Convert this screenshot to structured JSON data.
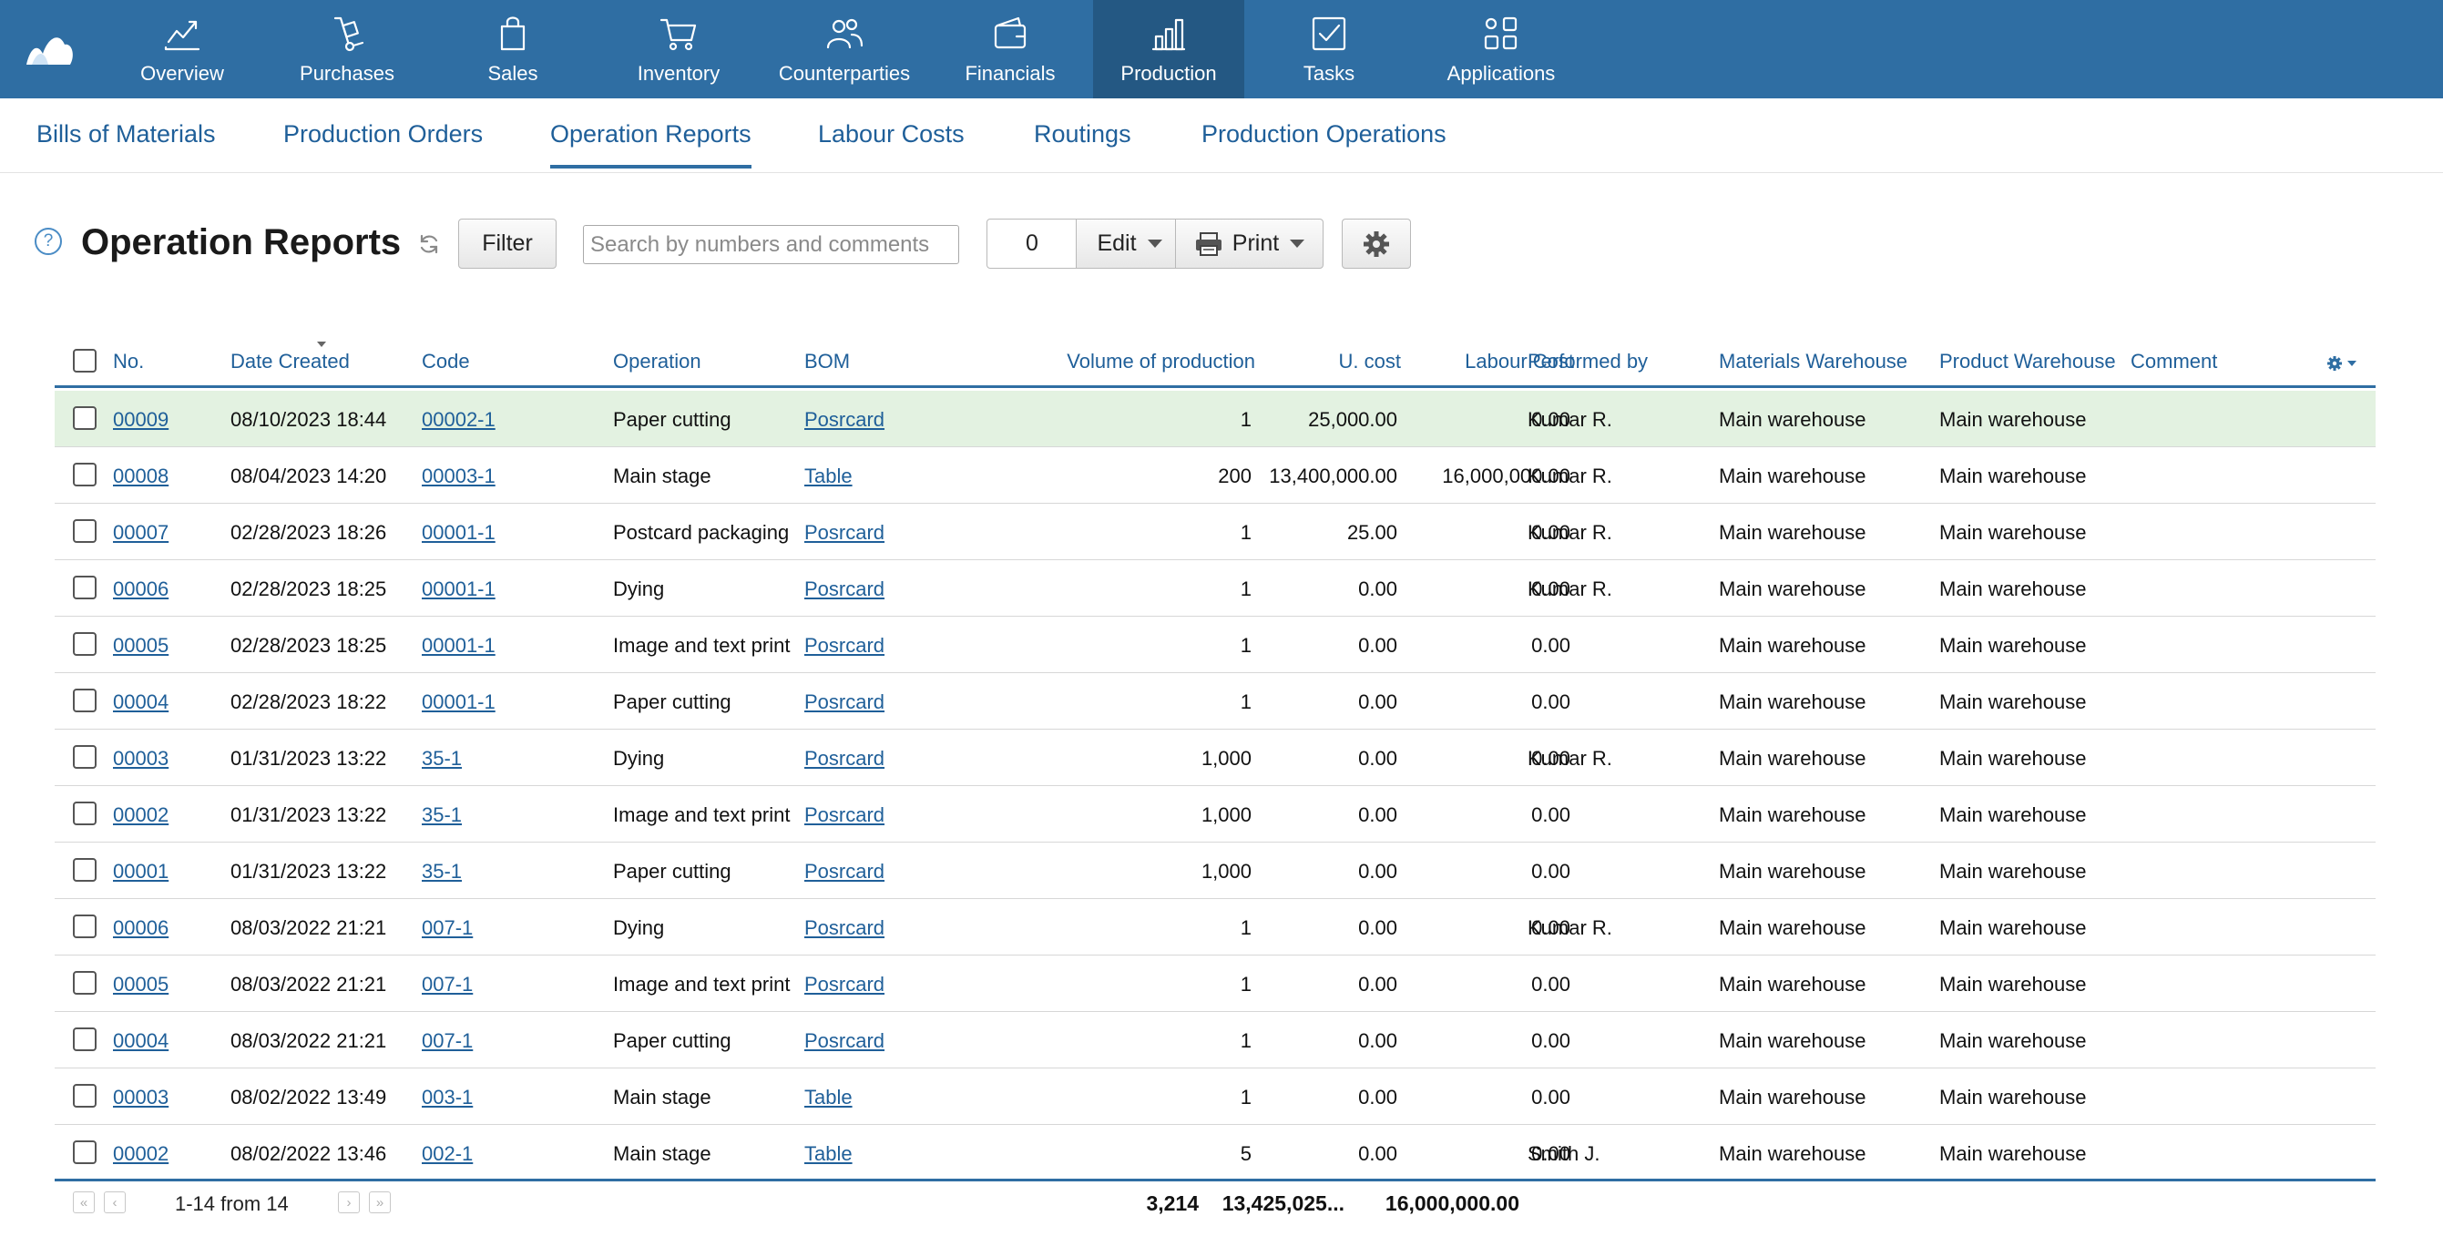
{
  "nav": {
    "items": [
      {
        "label": "Overview",
        "icon": "chart-line-icon"
      },
      {
        "label": "Purchases",
        "icon": "hand-truck-icon"
      },
      {
        "label": "Sales",
        "icon": "shopping-bag-icon"
      },
      {
        "label": "Inventory",
        "icon": "cart-icon"
      },
      {
        "label": "Counterparties",
        "icon": "people-icon"
      },
      {
        "label": "Financials",
        "icon": "wallet-icon"
      },
      {
        "label": "Production",
        "icon": "bar-chart-icon"
      },
      {
        "label": "Tasks",
        "icon": "checkbox-icon"
      },
      {
        "label": "Applications",
        "icon": "apps-icon"
      }
    ],
    "active": "Production"
  },
  "subnav": {
    "tabs": [
      "Bills of Materials",
      "Production Orders",
      "Operation Reports",
      "Labour Costs",
      "Routings",
      "Production Operations"
    ],
    "active": "Operation Reports"
  },
  "toolbar": {
    "title": "Operation Reports",
    "help": "?",
    "filter_label": "Filter",
    "search_placeholder": "Search by numbers and comments",
    "selected_count": "0",
    "edit_label": "Edit",
    "print_label": "Print"
  },
  "table": {
    "columns": {
      "no": "No.",
      "date": "Date Created",
      "code": "Code",
      "operation": "Operation",
      "bom": "BOM",
      "volume": "Volume of production",
      "ucost": "U. cost",
      "labour": "Labour Cost",
      "performed": "Performed by",
      "mat_wh": "Materials Warehouse",
      "prod_wh": "Product Warehouse",
      "comment": "Comment"
    },
    "rows": [
      {
        "no": "00009",
        "date": "08/10/2023 18:44",
        "code": "00002-1",
        "operation": "Paper cutting",
        "bom": "Posrcard",
        "volume": "1",
        "ucost": "25,000.00",
        "labour": "0.00",
        "performed": "Kumar R.",
        "mat_wh": "Main warehouse",
        "prod_wh": "Main warehouse",
        "comment": ""
      },
      {
        "no": "00008",
        "date": "08/04/2023 14:20",
        "code": "00003-1",
        "operation": "Main stage",
        "bom": "Table",
        "volume": "200",
        "ucost": "13,400,000.00",
        "labour": "16,000,000.00",
        "performed": "Kumar R.",
        "mat_wh": "Main warehouse",
        "prod_wh": "Main warehouse",
        "comment": ""
      },
      {
        "no": "00007",
        "date": "02/28/2023 18:26",
        "code": "00001-1",
        "operation": "Postcard packaging",
        "bom": "Posrcard",
        "volume": "1",
        "ucost": "25.00",
        "labour": "0.00",
        "performed": "Kumar R.",
        "mat_wh": "Main warehouse",
        "prod_wh": "Main warehouse",
        "comment": ""
      },
      {
        "no": "00006",
        "date": "02/28/2023 18:25",
        "code": "00001-1",
        "operation": "Dying",
        "bom": "Posrcard",
        "volume": "1",
        "ucost": "0.00",
        "labour": "0.00",
        "performed": "Kumar R.",
        "mat_wh": "Main warehouse",
        "prod_wh": "Main warehouse",
        "comment": ""
      },
      {
        "no": "00005",
        "date": "02/28/2023 18:25",
        "code": "00001-1",
        "operation": "Image and text print",
        "bom": "Posrcard",
        "volume": "1",
        "ucost": "0.00",
        "labour": "0.00",
        "performed": "",
        "mat_wh": "Main warehouse",
        "prod_wh": "Main warehouse",
        "comment": ""
      },
      {
        "no": "00004",
        "date": "02/28/2023 18:22",
        "code": "00001-1",
        "operation": "Paper cutting",
        "bom": "Posrcard",
        "volume": "1",
        "ucost": "0.00",
        "labour": "0.00",
        "performed": "",
        "mat_wh": "Main warehouse",
        "prod_wh": "Main warehouse",
        "comment": ""
      },
      {
        "no": "00003",
        "date": "01/31/2023 13:22",
        "code": "35-1",
        "operation": "Dying",
        "bom": "Posrcard",
        "volume": "1,000",
        "ucost": "0.00",
        "labour": "0.00",
        "performed": "Kumar R.",
        "mat_wh": "Main warehouse",
        "prod_wh": "Main warehouse",
        "comment": ""
      },
      {
        "no": "00002",
        "date": "01/31/2023 13:22",
        "code": "35-1",
        "operation": "Image and text print",
        "bom": "Posrcard",
        "volume": "1,000",
        "ucost": "0.00",
        "labour": "0.00",
        "performed": "",
        "mat_wh": "Main warehouse",
        "prod_wh": "Main warehouse",
        "comment": ""
      },
      {
        "no": "00001",
        "date": "01/31/2023 13:22",
        "code": "35-1",
        "operation": "Paper cutting",
        "bom": "Posrcard",
        "volume": "1,000",
        "ucost": "0.00",
        "labour": "0.00",
        "performed": "",
        "mat_wh": "Main warehouse",
        "prod_wh": "Main warehouse",
        "comment": ""
      },
      {
        "no": "00006",
        "date": "08/03/2022 21:21",
        "code": "007-1",
        "operation": "Dying",
        "bom": "Posrcard",
        "volume": "1",
        "ucost": "0.00",
        "labour": "0.00",
        "performed": "Kumar R.",
        "mat_wh": "Main warehouse",
        "prod_wh": "Main warehouse",
        "comment": ""
      },
      {
        "no": "00005",
        "date": "08/03/2022 21:21",
        "code": "007-1",
        "operation": "Image and text print",
        "bom": "Posrcard",
        "volume": "1",
        "ucost": "0.00",
        "labour": "0.00",
        "performed": "",
        "mat_wh": "Main warehouse",
        "prod_wh": "Main warehouse",
        "comment": ""
      },
      {
        "no": "00004",
        "date": "08/03/2022 21:21",
        "code": "007-1",
        "operation": "Paper cutting",
        "bom": "Posrcard",
        "volume": "1",
        "ucost": "0.00",
        "labour": "0.00",
        "performed": "",
        "mat_wh": "Main warehouse",
        "prod_wh": "Main warehouse",
        "comment": ""
      },
      {
        "no": "00003",
        "date": "08/02/2022 13:49",
        "code": "003-1",
        "operation": "Main stage",
        "bom": "Table",
        "volume": "1",
        "ucost": "0.00",
        "labour": "0.00",
        "performed": "",
        "mat_wh": "Main warehouse",
        "prod_wh": "Main warehouse",
        "comment": ""
      },
      {
        "no": "00002",
        "date": "08/02/2022 13:46",
        "code": "002-1",
        "operation": "Main stage",
        "bom": "Table",
        "volume": "5",
        "ucost": "0.00",
        "labour": "0.00",
        "performed": "Smith J.",
        "mat_wh": "Main warehouse",
        "prod_wh": "Main warehouse",
        "comment": ""
      }
    ],
    "selected_row": 0,
    "sort_column": "Date Created",
    "sort_direction": "descending"
  },
  "footer": {
    "pagination": "1-14 from 14",
    "total_volume": "3,214",
    "total_ucost": "13,425,025...",
    "total_labour": "16,000,000.00"
  },
  "colors": {
    "nav_bg": "#2f6ea3",
    "nav_active": "#245883",
    "link": "#1f5f99",
    "selected_row": "#e3f2e1"
  }
}
